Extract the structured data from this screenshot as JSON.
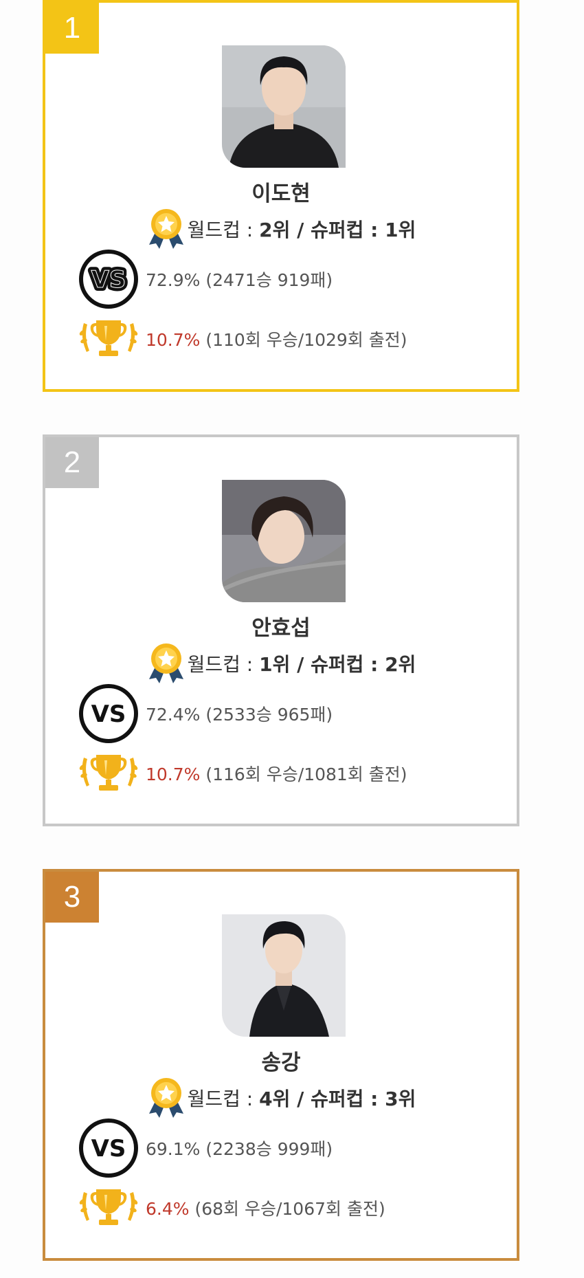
{
  "cards": [
    {
      "rank": "1",
      "border_color": "#f3c416",
      "badge_color": "#f3c416",
      "name": "이도현",
      "rank_label_prefix": "월드컵 : ",
      "worldcup_rank": "2위",
      "rank_separator": " / ",
      "supercup_label": "슈퍼컵 : ",
      "supercup_rank": "1위",
      "vs_text": "72.9% (2471승 919패)",
      "win_pct": "10.7%",
      "win_detail": " (110회 우승/1029회 출전)"
    },
    {
      "rank": "2",
      "border_color": "#c8c8c8",
      "badge_color": "#c2c2c2",
      "name": "안효섭",
      "rank_label_prefix": "월드컵 : ",
      "worldcup_rank": "1위",
      "rank_separator": " / ",
      "supercup_label": "슈퍼컵 : ",
      "supercup_rank": "2위",
      "vs_text": "72.4% (2533승 965패)",
      "win_pct": "10.7%",
      "win_detail": " (116회 우승/1081회 출전)"
    },
    {
      "rank": "3",
      "border_color": "#c98c3e",
      "badge_color": "#cc8232",
      "name": "송강",
      "rank_label_prefix": "월드컵 : ",
      "worldcup_rank": "4위",
      "rank_separator": " / ",
      "supercup_label": "슈퍼컵 : ",
      "supercup_rank": "3위",
      "vs_text": "69.1% (2238승 999패)",
      "win_pct": "6.4%",
      "win_detail": " (68회 우승/1067회 출전)"
    }
  ],
  "icons": {
    "medal": "medal-icon",
    "vs": "vs-icon",
    "trophy": "trophy-icon"
  }
}
